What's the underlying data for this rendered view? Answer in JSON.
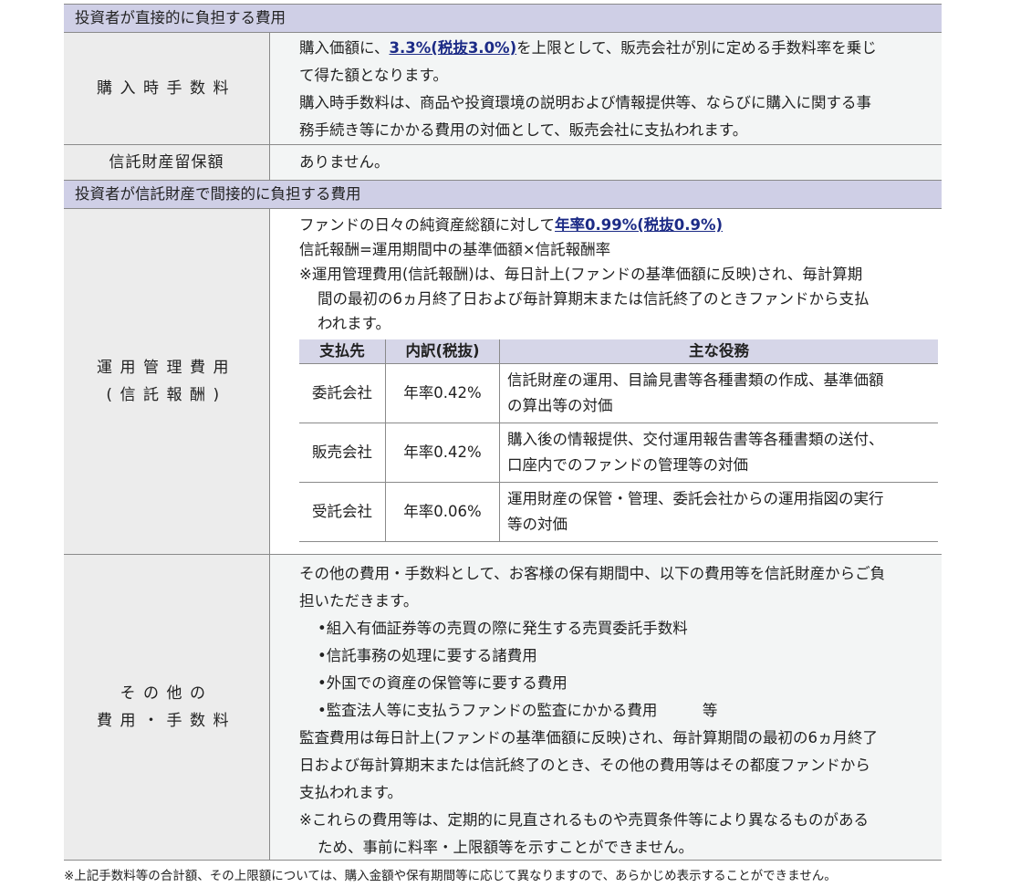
{
  "section1": {
    "title": "投資者が直接的に負担する費用",
    "rows": [
      {
        "label": "購入時手数料",
        "lines": {
          "l1_pre": "購入価額に、",
          "l1_link": "3.3%(税抜3.0%)",
          "l1_post": "を上限として、販売会社が別に定める手数料率を乗じ",
          "l2": "て得た額となります。",
          "l3": "購入時手数料は、商品や投資環境の説明および情報提供等、ならびに購入に関する事",
          "l4": "務手続き等にかかる費用の対価として、販売会社に支払われます。"
        }
      },
      {
        "label": "信託財産留保額",
        "text": "ありません。"
      }
    ]
  },
  "section2": {
    "title": "投資者が信託財産で間接的に負担する費用",
    "mgmt": {
      "label_1": "運用管理費用",
      "label_2": "(信託報酬)",
      "l1_pre": "ファンドの日々の純資産総額に対して",
      "l1_link": "年率0.99%(税抜0.9%)",
      "l2": "信託報酬=運用期間中の基準価額×信託報酬率",
      "note_1": "※運用管理費用(信託報酬)は、毎日計上(ファンドの基準価額に反映)され、毎計算期",
      "note_2": "間の最初の6ヵ月終了日および毎計算期末または信託終了のときファンドから支払",
      "note_3": "われます。",
      "table": {
        "headers": [
          "支払先",
          "内訳(税抜)",
          "主な役務"
        ],
        "rows": [
          {
            "payee": "委託会社",
            "rate": "年率0.42%",
            "duty_1": "信託財産の運用、目論見書等各種書類の作成、基準価額",
            "duty_2": "の算出等の対価"
          },
          {
            "payee": "販売会社",
            "rate": "年率0.42%",
            "duty_1": "購入後の情報提供、交付運用報告書等各種書類の送付、",
            "duty_2": "口座内でのファンドの管理等の対価"
          },
          {
            "payee": "受託会社",
            "rate": "年率0.06%",
            "duty_1": "運用財産の保管・管理、委託会社からの運用指図の実行",
            "duty_2": "等の対価"
          }
        ]
      }
    },
    "other": {
      "label_1": "その他の",
      "label_2": "費用・手数料",
      "intro_1": "その他の費用・手数料として、お客様の保有期間中、以下の費用等を信託財産からご負",
      "intro_2": "担いただきます。",
      "bullets": [
        "•組入有価証券等の売買の際に発生する売買委託手数料",
        "•信託事務の処理に要する諸費用",
        "•外国での資産の保管等に要する費用",
        "•監査法人等に支払うファンドの監査にかかる費用　　　等"
      ],
      "audit_1": "監査費用は毎日計上(ファンドの基準価額に反映)され、毎計算期間の最初の6ヵ月終了",
      "audit_2": "日および毎計算期末または信託終了のとき、その他の費用等はその都度ファンドから",
      "audit_3": "支払われます。",
      "note_1": "※これらの費用等は、定期的に見直されるものや売買条件等により異なるものがある",
      "note_2": "ため、事前に料率・上限額等を示すことができません。"
    }
  },
  "footnote": "※上記手数料等の合計額、その上限額については、購入金額や保有期間等に応じて異なりますので、あらかじめ表示することができません。"
}
